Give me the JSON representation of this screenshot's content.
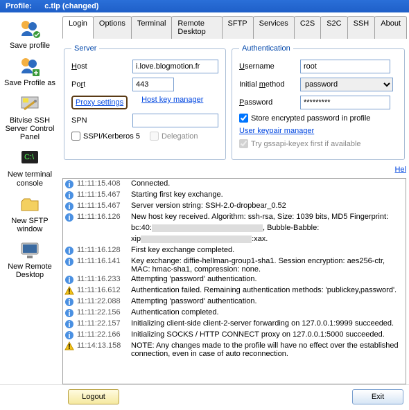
{
  "title": {
    "prefix": "Profile:",
    "name": "c.tlp (changed)"
  },
  "sidebar": {
    "items": [
      {
        "label": "Save profile"
      },
      {
        "label": "Save Profile as"
      },
      {
        "label": "Bitvise SSH Server Control Panel"
      },
      {
        "label": "New terminal console"
      },
      {
        "label": "New SFTP window"
      },
      {
        "label": "New Remote Desktop"
      }
    ]
  },
  "tabs": [
    "Login",
    "Options",
    "Terminal",
    "Remote Desktop",
    "SFTP",
    "Services",
    "C2S",
    "S2C",
    "SSH",
    "About"
  ],
  "server": {
    "legend": "Server",
    "host_label": "Host",
    "host": "i.love.blogmotion.fr",
    "port_label": "Port",
    "port": "443",
    "proxy_link": "Proxy settings",
    "hostkey_link": "Host key manager",
    "spn_label": "SPN",
    "spn": "",
    "sspi_label": "SSPI/Kerberos 5",
    "delegation_label": "Delegation"
  },
  "auth": {
    "legend": "Authentication",
    "username_label": "Username",
    "username": "root",
    "method_label": "Initial method",
    "method": "password",
    "password_label": "Password",
    "password": "*********",
    "store_label": "Store encrypted password in profile",
    "keypair_link": "User keypair manager",
    "gssapi_label": "Try gssapi-keyex first if available"
  },
  "help_label": "Hel",
  "log": [
    {
      "t": "i",
      "ts": "11:11:15.408",
      "msg": "Connected."
    },
    {
      "t": "i",
      "ts": "11:11:15.467",
      "msg": "Starting first key exchange."
    },
    {
      "t": "i",
      "ts": "11:11:15.467",
      "msg": "Server version string: SSH-2.0-dropbear_0.52"
    },
    {
      "t": "i",
      "ts": "11:11:16.126",
      "msg": "New host key received. Algorithm: ssh-rsa, Size: 1039 bits, MD5 Fingerprint:"
    },
    {
      "t": "",
      "ts": "",
      "msg": "bc:40:________________________________________, Bubble-Babble:"
    },
    {
      "t": "",
      "ts": "",
      "msg": "xip________________________________________:xax."
    },
    {
      "t": "i",
      "ts": "11:11:16.128",
      "msg": "First key exchange completed."
    },
    {
      "t": "i",
      "ts": "11:11:16.141",
      "msg": "Key exchange: diffie-hellman-group1-sha1. Session encryption: aes256-ctr, MAC: hmac-sha1, compression: none."
    },
    {
      "t": "i",
      "ts": "11:11:16.233",
      "msg": "Attempting 'password' authentication."
    },
    {
      "t": "w",
      "ts": "11:11:16.612",
      "msg": "Authentication failed. Remaining authentication methods: 'publickey,password'."
    },
    {
      "t": "i",
      "ts": "11:11:22.088",
      "msg": "Attempting 'password' authentication."
    },
    {
      "t": "i",
      "ts": "11:11:22.156",
      "msg": "Authentication completed."
    },
    {
      "t": "i",
      "ts": "11:11:22.157",
      "msg": "Initializing client-side client-2-server forwarding on 127.0.0.1:9999 succeeded."
    },
    {
      "t": "i",
      "ts": "11:11:22.166",
      "msg": "Initializing SOCKS / HTTP CONNECT proxy on 127.0.0.1:5000 succeeded."
    },
    {
      "t": "w",
      "ts": "11:14:13.158",
      "msg": "NOTE: Any changes made to the profile will have no effect over the established connection, even in case of auto reconnection."
    }
  ],
  "buttons": {
    "logout": "Logout",
    "exit": "Exit"
  }
}
